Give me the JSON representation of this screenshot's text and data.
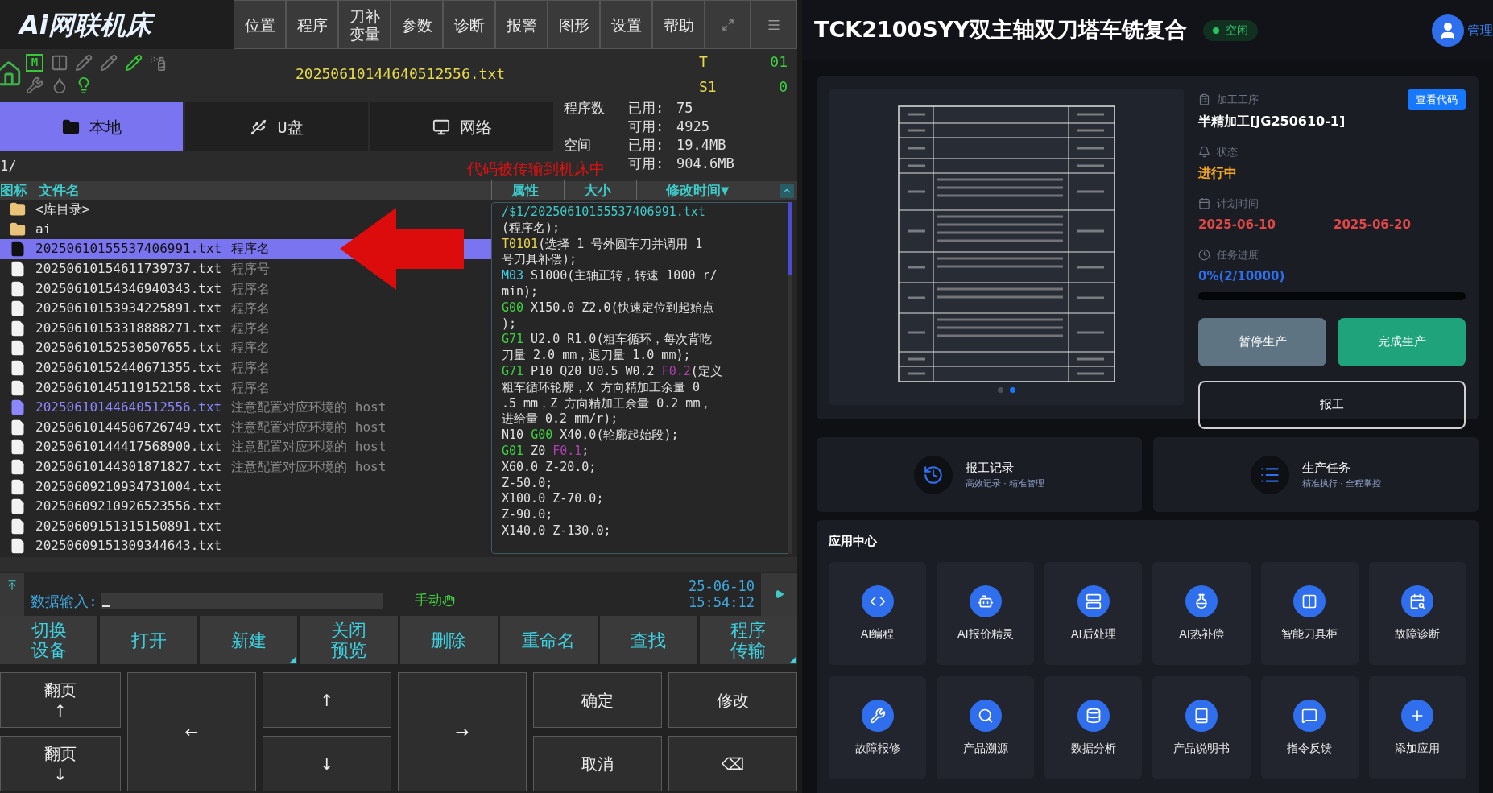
{
  "cnc": {
    "logo": "Ai网联机床",
    "menu": [
      {
        "lines": [
          "位置"
        ]
      },
      {
        "lines": [
          "程序"
        ]
      },
      {
        "lines": [
          "刀补",
          "变量"
        ]
      },
      {
        "lines": [
          "参数"
        ]
      },
      {
        "lines": [
          "诊断"
        ]
      },
      {
        "lines": [
          "报警"
        ]
      },
      {
        "lines": [
          "图形"
        ]
      },
      {
        "lines": [
          "设置"
        ]
      },
      {
        "lines": [
          "帮助"
        ]
      }
    ],
    "status_icons": [
      {
        "kind": "m",
        "label": "M",
        "active": true
      },
      {
        "kind": "door",
        "active": false
      },
      {
        "kind": "tool",
        "active": false
      },
      {
        "kind": "tool",
        "active": false
      },
      {
        "kind": "tool",
        "active": true
      },
      {
        "kind": "spray",
        "active": false
      },
      {
        "kind": "wrench",
        "active": false
      },
      {
        "kind": "oil",
        "active": false
      },
      {
        "kind": "light",
        "active": true
      }
    ],
    "filename": "20250610144640512556.txt",
    "readouts": [
      {
        "label": "T",
        "value": "01"
      },
      {
        "label": "S1",
        "value": "0"
      }
    ],
    "storage_tabs": [
      {
        "label": "本地",
        "kind": "folder",
        "selected": true
      },
      {
        "label": "U盘",
        "kind": "usb",
        "selected": false
      },
      {
        "label": "网络",
        "kind": "network",
        "selected": false
      }
    ],
    "stats": [
      {
        "label": "程序数",
        "used_label": "已用:",
        "used": "75",
        "free_label": "可用:",
        "free": "4925"
      },
      {
        "label": "空间",
        "used_label": "已用:",
        "used": "19.4MB",
        "free_label": "可用:",
        "free": "904.6MB"
      }
    ],
    "path": "1/",
    "annotation": "代码被传输到机床中",
    "columns": [
      "图标",
      "文件名",
      "属性",
      "大小",
      "修改时间▼"
    ],
    "files": [
      {
        "kind": "folder",
        "name": "<库目录>",
        "selected": false,
        "current": false
      },
      {
        "kind": "folder",
        "name": "ai",
        "selected": false,
        "current": false
      },
      {
        "kind": "file",
        "name": "20250610155537406991.txt",
        "note": "程序名",
        "selected": true,
        "current": false
      },
      {
        "kind": "file",
        "name": "20250610154611739737.txt",
        "note": "程序号",
        "selected": false,
        "current": false
      },
      {
        "kind": "file",
        "name": "20250610154346940343.txt",
        "note": "程序名",
        "selected": false,
        "current": false
      },
      {
        "kind": "file",
        "name": "20250610153934225891.txt",
        "note": "程序名",
        "selected": false,
        "current": false
      },
      {
        "kind": "file",
        "name": "20250610153318888271.txt",
        "note": "程序名",
        "selected": false,
        "current": false
      },
      {
        "kind": "file",
        "name": "20250610152530507655.txt",
        "note": "程序名",
        "selected": false,
        "current": false
      },
      {
        "kind": "file",
        "name": "20250610152440671355.txt",
        "note": "程序名",
        "selected": false,
        "current": false
      },
      {
        "kind": "file",
        "name": "20250610145119152158.txt",
        "note": "程序名",
        "selected": false,
        "current": false
      },
      {
        "kind": "file",
        "name": "20250610144640512556.txt",
        "note": "注意配置对应环境的 host",
        "selected": false,
        "current": true
      },
      {
        "kind": "file",
        "name": "20250610144506726749.txt",
        "note": "注意配置对应环境的 host",
        "selected": false,
        "current": false
      },
      {
        "kind": "file",
        "name": "20250610144417568900.txt",
        "note": "注意配置对应环境的 host",
        "selected": false,
        "current": false
      },
      {
        "kind": "file",
        "name": "20250610144301871827.txt",
        "note": "注意配置对应环境的 host",
        "selected": false,
        "current": false
      },
      {
        "kind": "file",
        "name": "20250609210934731004.txt",
        "selected": false,
        "current": false
      },
      {
        "kind": "file",
        "name": "20250609210926523556.txt",
        "selected": false,
        "current": false
      },
      {
        "kind": "file",
        "name": "20250609151315150891.txt",
        "selected": false,
        "current": false
      },
      {
        "kind": "file",
        "name": "20250609151309344643.txt",
        "selected": false,
        "current": false
      }
    ],
    "preview": [
      [
        {
          "kind": "path",
          "text": "/$1/20250610155537406991.txt"
        }
      ],
      [
        {
          "kind": "plain",
          "text": "(程序名);"
        }
      ],
      [
        {
          "kind": "tool",
          "text": "T0101"
        },
        {
          "kind": "plain",
          "text": "(选择 1 号外圆车刀并调用 1"
        }
      ],
      [
        {
          "kind": "plain",
          "text": "号刀具补偿);"
        }
      ],
      [
        {
          "kind": "m",
          "text": "M03"
        },
        {
          "kind": "plain",
          "text": " S1000(主轴正转，转速 1000 r/"
        }
      ],
      [
        {
          "kind": "plain",
          "text": "min);"
        }
      ],
      [
        {
          "kind": "g",
          "text": "G00"
        },
        {
          "kind": "plain",
          "text": " X150.0 Z2.0(快速定位到起始点"
        }
      ],
      [
        {
          "kind": "plain",
          "text": ");"
        }
      ],
      [
        {
          "kind": "g",
          "text": "G71"
        },
        {
          "kind": "plain",
          "text": " U2.0 R1.0(粗车循环，每次背吃"
        }
      ],
      [
        {
          "kind": "plain",
          "text": "刀量 2.0 mm，退刀量 1.0 mm);"
        }
      ],
      [
        {
          "kind": "g",
          "text": "G71"
        },
        {
          "kind": "plain",
          "text": " P10 Q20 U0.5 W0.2 "
        },
        {
          "kind": "f",
          "text": "F0.2"
        },
        {
          "kind": "plain",
          "text": "(定义"
        }
      ],
      [
        {
          "kind": "plain",
          "text": "粗车循环轮廓，X 方向精加工余量 0"
        }
      ],
      [
        {
          "kind": "plain",
          "text": ".5 mm，Z 方向精加工余量 0.2 mm，"
        }
      ],
      [
        {
          "kind": "plain",
          "text": "进给量 0.2 mm/r);"
        }
      ],
      [
        {
          "kind": "plain",
          "text": "N10 "
        },
        {
          "kind": "g",
          "text": "G00"
        },
        {
          "kind": "plain",
          "text": " X40.0(轮廓起始段);"
        }
      ],
      [
        {
          "kind": "g",
          "text": "G01"
        },
        {
          "kind": "plain",
          "text": " Z0 "
        },
        {
          "kind": "f",
          "text": "F0.1"
        },
        {
          "kind": "plain",
          "text": ";"
        }
      ],
      [
        {
          "kind": "plain",
          "text": "X60.0 Z-20.0;"
        }
      ],
      [
        {
          "kind": "plain",
          "text": "Z-50.0;"
        }
      ],
      [
        {
          "kind": "plain",
          "text": "X100.0 Z-70.0;"
        }
      ],
      [
        {
          "kind": "plain",
          "text": "Z-90.0;"
        }
      ],
      [
        {
          "kind": "plain",
          "text": "X140.0 Z-130.0;"
        }
      ]
    ],
    "input_label": "数据输入:",
    "mode": "手动",
    "date": "25-06-10",
    "time": "15:54:12",
    "softkeys": [
      {
        "lines": [
          "切换",
          "设备"
        ],
        "has_menu": false
      },
      {
        "lines": [
          "打开"
        ],
        "has_menu": false
      },
      {
        "lines": [
          "新建"
        ],
        "has_menu": true
      },
      {
        "lines": [
          "关闭",
          "预览"
        ],
        "has_menu": false
      },
      {
        "lines": [
          "删除"
        ],
        "has_menu": false
      },
      {
        "lines": [
          "重命名"
        ],
        "has_menu": false
      },
      {
        "lines": [
          "查找"
        ],
        "has_menu": false
      },
      {
        "lines": [
          "程序",
          "传输"
        ],
        "has_menu": true
      }
    ],
    "keypad": [
      {
        "lines": [
          "翻页",
          "↑"
        ],
        "tall": false
      },
      {
        "lines": [
          "翻页",
          "↓"
        ],
        "tall": false
      },
      {
        "lines": [
          "←"
        ],
        "tall": true
      },
      {
        "lines": [
          "↑"
        ],
        "tall": false
      },
      {
        "lines": [
          "↓"
        ],
        "tall": false
      },
      {
        "lines": [
          "→"
        ],
        "tall": true
      },
      {
        "lines": [
          "确定"
        ],
        "tall": false
      },
      {
        "lines": [
          "取消"
        ],
        "tall": false
      },
      {
        "lines": [
          "修改"
        ],
        "tall": false
      },
      {
        "lines": [
          "⌫"
        ],
        "tall": false
      }
    ]
  },
  "mes": {
    "title": "TCK2100SYY双主轴双刀塔车铣复合",
    "status": "空闲",
    "user": "管理",
    "slides": [
      {
        "selected": false
      },
      {
        "selected": true
      }
    ],
    "process_label": "加工工序",
    "process": "半精加工[JG250610-1]",
    "view_code": "查看代码",
    "state_label": "状态",
    "state": "进行中",
    "plan_label": "计划时间",
    "start": "2025-06-10",
    "end": "2025-06-20",
    "progress_label": "任务进度",
    "progress_text": "0%(2/10000)",
    "level": 0.0002,
    "buttons": [
      {
        "label": "暂停生产",
        "kind": "pause"
      },
      {
        "label": "完成生产",
        "kind": "complete"
      },
      {
        "label": "报工",
        "kind": "report"
      }
    ],
    "quick_cards": [
      {
        "kind": "history",
        "title": "报工记录",
        "subtitle": "高效记录 · 精准管理"
      },
      {
        "kind": "list",
        "title": "生产任务",
        "subtitle": "精准执行 · 全程掌控"
      }
    ],
    "apps_title": "应用中心",
    "apps": [
      {
        "kind": "code",
        "label": "AI编程"
      },
      {
        "kind": "robot",
        "label": "AI报价精灵"
      },
      {
        "kind": "server",
        "label": "AI后处理"
      },
      {
        "kind": "flask",
        "label": "AI热补偿"
      },
      {
        "kind": "cabinet",
        "label": "智能刀具柜"
      },
      {
        "kind": "calendar",
        "label": "故障诊断"
      },
      {
        "kind": "wrench",
        "label": "故障报修"
      },
      {
        "kind": "search",
        "label": "产品溯源"
      },
      {
        "kind": "data",
        "label": "数据分析"
      },
      {
        "kind": "book",
        "label": "产品说明书"
      },
      {
        "kind": "feedback",
        "label": "指令反馈"
      },
      {
        "kind": "add",
        "label": "添加应用"
      }
    ]
  }
}
